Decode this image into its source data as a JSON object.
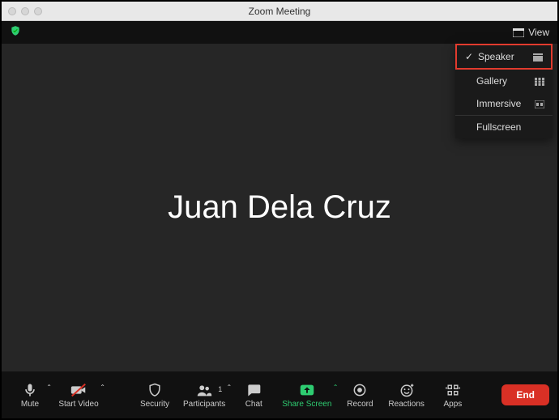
{
  "window": {
    "title": "Zoom Meeting"
  },
  "topbar": {
    "view_label": "View"
  },
  "view_menu": {
    "items": [
      {
        "label": "Speaker",
        "selected": true
      },
      {
        "label": "Gallery",
        "selected": false
      },
      {
        "label": "Immersive",
        "selected": false
      },
      {
        "label": "Fullscreen",
        "selected": false
      }
    ]
  },
  "stage": {
    "participant_name": "Juan Dela Cruz"
  },
  "controls": {
    "mute": "Mute",
    "start_video": "Start Video",
    "security": "Security",
    "participants": "Participants",
    "participants_count": "1",
    "chat": "Chat",
    "share_screen": "Share Screen",
    "record": "Record",
    "reactions": "Reactions",
    "apps": "Apps",
    "end": "End"
  }
}
